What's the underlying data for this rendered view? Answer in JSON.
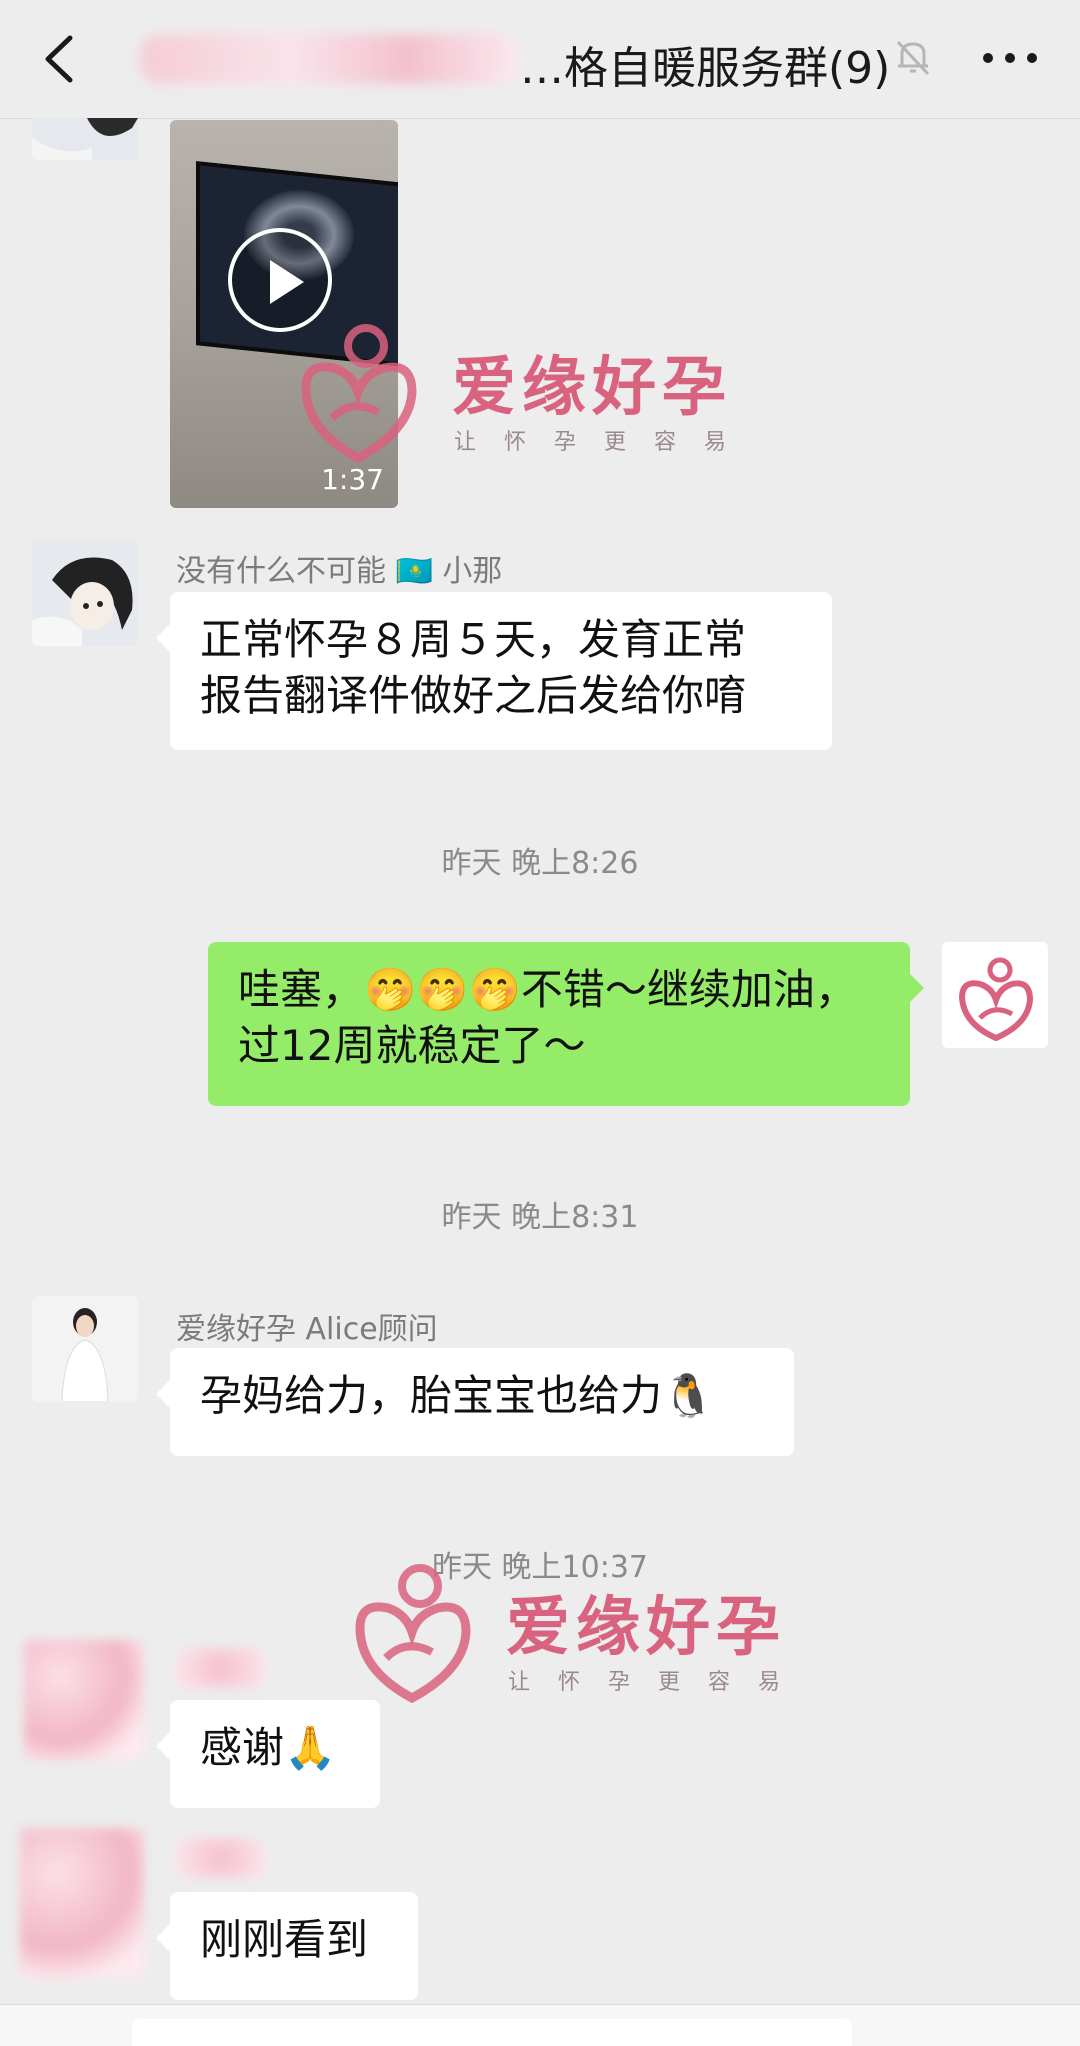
{
  "header": {
    "title": "…格自暖服务群(9)"
  },
  "messages": {
    "video": {
      "duration": "1:37"
    },
    "msg1": {
      "sender": "没有什么不可能 🇰🇿 小那",
      "line1": "正常怀孕８周５天，发育正常",
      "line2": "报告翻译件做好之后发给你唷"
    },
    "time1": "昨天 晚上8:26",
    "msg2": {
      "line1_pre": "哇塞，",
      "line1_emoji": "🤭🤭🤭",
      "line1_post": "不错～继续加油，",
      "line2": "过12周就稳定了～"
    },
    "time2": "昨天 晚上8:31",
    "msg3": {
      "sender": "爱缘好孕 Alice顾问",
      "text": "孕妈给力，胎宝宝也给力",
      "emoji": "🐧"
    },
    "time3": "昨天 晚上10:37",
    "msg4": {
      "text": "感谢",
      "emoji": "🙏"
    },
    "msg5": {
      "text": "刚刚看到"
    }
  },
  "watermark": {
    "title": "爱缘好孕",
    "subtitle": "让怀孕更容易"
  },
  "colors": {
    "background": "#ededed",
    "my_bubble": "#95ec69",
    "other_bubble": "#ffffff",
    "brand_pink": "#d9627e"
  }
}
